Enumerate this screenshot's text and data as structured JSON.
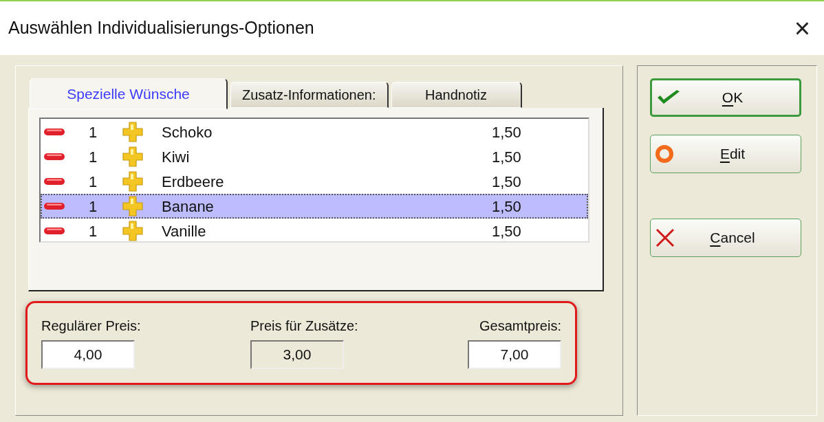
{
  "window": {
    "title": "Auswählen Individualisierungs-Optionen",
    "close": "×"
  },
  "tabs": [
    {
      "label": "Spezielle Wünsche",
      "selected": true
    },
    {
      "label": "Zusatz-Informationen:",
      "selected": false
    },
    {
      "label": "Handnotiz",
      "selected": false
    }
  ],
  "items": [
    {
      "quantity": "1",
      "name": "Schoko",
      "price": "1,50",
      "selected": false
    },
    {
      "quantity": "1",
      "name": "Kiwi",
      "price": "1,50",
      "selected": false
    },
    {
      "quantity": "1",
      "name": "Erdbeere",
      "price": "1,50",
      "selected": false
    },
    {
      "quantity": "1",
      "name": "Banane",
      "price": "1,50",
      "selected": true
    },
    {
      "quantity": "1",
      "name": "Vanille",
      "price": "1,50",
      "selected": false
    }
  ],
  "prices": {
    "highlighted": true,
    "fields": [
      {
        "label": "Regulärer Preis:",
        "value": "4,00",
        "disabled": false
      },
      {
        "label": "Preis für Zusätze:",
        "value": "3,00",
        "disabled": true
      },
      {
        "label": "Gesamtpreis:",
        "value": "7,00",
        "disabled": false
      }
    ]
  },
  "buttons": [
    {
      "kind": "ok",
      "mnemonic": "O",
      "rest": "K",
      "default": true
    },
    {
      "kind": "edit",
      "mnemonic": "E",
      "rest": "dit",
      "default": false
    },
    {
      "kind": "cancel",
      "mnemonic": "C",
      "rest": "ancel",
      "default": false
    }
  ]
}
